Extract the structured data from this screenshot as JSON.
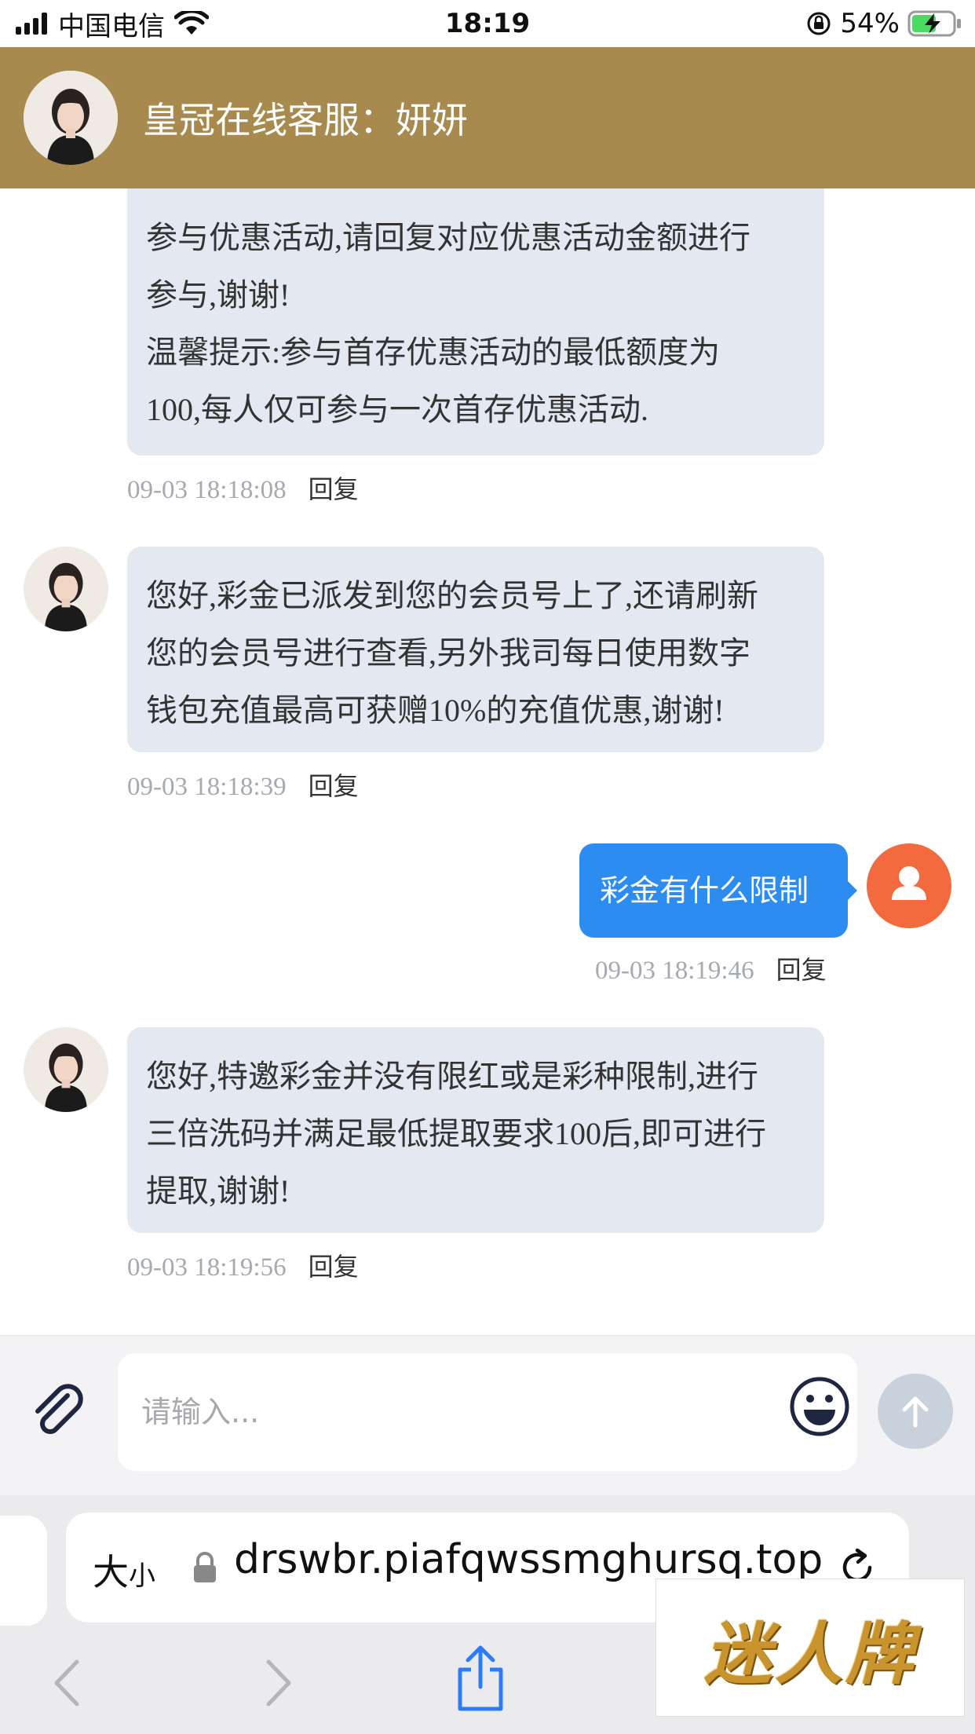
{
  "status_bar": {
    "carrier": "中国电信",
    "time": "18:19",
    "battery_percent": "54%"
  },
  "header": {
    "title": "皇冠在线客服：妍妍"
  },
  "messages": [
    {
      "sender": "agent",
      "lines": [
        "参与优惠活动,请回复对应优惠活动金额进行",
        "参与,谢谢!",
        "温馨提示:参与首存优惠活动的最低额度为",
        "100,每人仅可参与一次首存优惠活动."
      ],
      "timestamp": "09-03 18:18:08",
      "reply_label": "回复"
    },
    {
      "sender": "agent",
      "lines": [
        "您好,彩金已派发到您的会员号上了,还请刷新",
        "您的会员号进行查看,另外我司每日使用数字",
        "钱包充值最高可获赠10%的充值优惠,谢谢!"
      ],
      "timestamp": "09-03 18:18:39",
      "reply_label": "回复"
    },
    {
      "sender": "user",
      "lines": [
        "彩金有什么限制"
      ],
      "timestamp": "09-03 18:19:46",
      "reply_label": "回复"
    },
    {
      "sender": "agent",
      "lines": [
        "您好,特邀彩金并没有限红或是彩种限制,进行",
        "三倍洗码并满足最低提取要求100后,即可进行",
        "提取,谢谢!"
      ],
      "timestamp": "09-03 18:19:56",
      "reply_label": "回复"
    }
  ],
  "composer": {
    "placeholder": "请输入..."
  },
  "browser": {
    "text_size_label": "大",
    "text_size_small": "小",
    "url": "drswbr.piafqwssmghursq.top"
  },
  "watermark": {
    "text": "迷人牌"
  },
  "colors": {
    "header_bg": "#a88a4e",
    "agent_bubble": "#e4e9f1",
    "user_bubble": "#2d8cf0",
    "user_avatar": "#f26a3e"
  }
}
